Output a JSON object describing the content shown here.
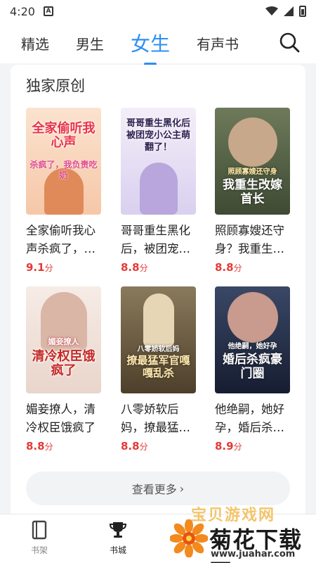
{
  "status": {
    "time": "4:20",
    "a_badge": "A"
  },
  "nav": {
    "tabs": [
      {
        "label": "精选",
        "active": false
      },
      {
        "label": "男生",
        "active": false
      },
      {
        "label": "女生",
        "active": true
      },
      {
        "label": "有声书",
        "active": false
      }
    ],
    "accent_color": "#2c8ff5"
  },
  "section": {
    "title": "独家原创",
    "more_label": "查看更多",
    "more_chevron": "›"
  },
  "books": [
    {
      "cover_text": "全家偷听我心声",
      "cover_sub": "杀疯了，我负责吃奶",
      "title": "全家偷听我心声杀疯了，…",
      "score": "9.1",
      "unit": "分",
      "cover_bg": "#f7d9c4",
      "cover_fg": "#e8324a"
    },
    {
      "cover_text": "哥哥重生黑化后被团宠小公主萌翻了！",
      "cover_sub": "",
      "title": "哥哥重生黑化后，被团宠…",
      "score": "8.8",
      "unit": "分",
      "cover_bg": "#e9e3f3",
      "cover_fg": "#3a2a6a"
    },
    {
      "cover_text": "我重生改嫁首长",
      "cover_sub": "照顾寡嫂还守身",
      "title": "照顾寡嫂还守身？我重生…",
      "score": "8.8",
      "unit": "分",
      "cover_bg": "#4c5a3f",
      "cover_fg": "#ffffff"
    },
    {
      "cover_text": "清冷权臣饿疯了",
      "cover_sub": "媚妾撩人",
      "title": "媚妾撩人，清冷权臣饿疯了",
      "score": "8.8",
      "unit": "分",
      "cover_bg": "#f1e6e0",
      "cover_fg": "#c62828"
    },
    {
      "cover_text": "撩最猛军官嘎嘎乱杀",
      "cover_sub": "八零娇软后妈",
      "title": "八零娇软后妈，撩最猛…",
      "score": "8.8",
      "unit": "分",
      "cover_bg": "#6b5a3d",
      "cover_fg": "#ffe9b0"
    },
    {
      "cover_text": "婚后杀疯豪门圈",
      "cover_sub": "他绝嗣，她好孕",
      "title": "他绝嗣，她好孕，婚后杀…",
      "score": "8.9",
      "unit": "分",
      "cover_bg": "#1f2a44",
      "cover_fg": "#ffffff"
    }
  ],
  "bottom_nav": {
    "items": [
      {
        "label": "书架",
        "icon": "bookshelf-icon",
        "active": false
      },
      {
        "label": "书城",
        "icon": "trophy-icon",
        "active": true
      }
    ]
  },
  "watermark": {
    "top_text": "宝贝游戏网",
    "name": "菊花下载网",
    "url": "www.juahar.com"
  }
}
